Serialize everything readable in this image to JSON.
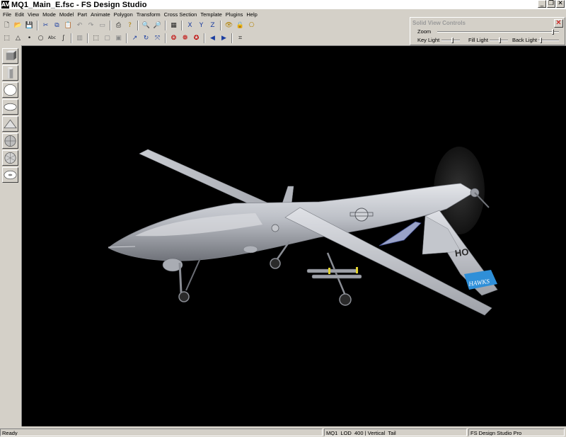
{
  "window": {
    "title": "MQ1_Main_E.fsc - FS Design Studio",
    "app_icon_glyph": "AV",
    "minimize_glyph": "_",
    "maximize_glyph": "❐",
    "close_glyph": "✕"
  },
  "menu": [
    "File",
    "Edit",
    "View",
    "Mode",
    "Model",
    "Part",
    "Animate",
    "Polygon",
    "Transform",
    "Cross Section",
    "Template",
    "Plugins",
    "Help"
  ],
  "toolbar1": [
    {
      "icon": "new-file-icon",
      "glyph": "🗋"
    },
    {
      "icon": "open-folder-icon",
      "glyph": "📂"
    },
    {
      "icon": "save-icon",
      "glyph": "💾"
    },
    {
      "sep": true
    },
    {
      "icon": "cut-icon",
      "glyph": "✂"
    },
    {
      "icon": "copy-icon",
      "glyph": "⧉"
    },
    {
      "icon": "paste-icon",
      "glyph": "📋"
    },
    {
      "icon": "undo-icon",
      "glyph": "↶"
    },
    {
      "icon": "redo-icon",
      "glyph": "↷"
    },
    {
      "icon": "grey-box-icon",
      "glyph": "▭"
    },
    {
      "sep": true
    },
    {
      "icon": "print-icon",
      "glyph": "⎙"
    },
    {
      "icon": "help-icon",
      "glyph": "?"
    },
    {
      "sep": true
    },
    {
      "icon": "zoom-in-icon",
      "glyph": "🔍"
    },
    {
      "icon": "zoom-out-icon",
      "glyph": "🔎"
    },
    {
      "sep": true
    },
    {
      "icon": "grid-icon",
      "glyph": "▦"
    },
    {
      "sep": true
    },
    {
      "icon": "axis-x-icon",
      "glyph": "X"
    },
    {
      "icon": "axis-y-icon",
      "glyph": "Y"
    },
    {
      "icon": "axis-z-icon",
      "glyph": "Z"
    },
    {
      "sep": true
    },
    {
      "icon": "eye-icon",
      "glyph": "👁"
    },
    {
      "icon": "lock-icon",
      "glyph": "🔒"
    },
    {
      "icon": "camera-icon",
      "glyph": "⎔"
    }
  ],
  "toolbar2": [
    {
      "icon": "select-box-icon",
      "glyph": "⬚"
    },
    {
      "icon": "triangle-icon",
      "glyph": "△"
    },
    {
      "icon": "point-icon",
      "glyph": "•"
    },
    {
      "icon": "circle-icon",
      "glyph": "○"
    },
    {
      "icon": "text-abc-icon",
      "glyph": "Abc"
    },
    {
      "icon": "spline-icon",
      "glyph": "∫"
    },
    {
      "sep": true
    },
    {
      "icon": "stamp-icon",
      "glyph": "▥"
    },
    {
      "sep": true
    },
    {
      "icon": "marquee-icon",
      "glyph": "⬚"
    },
    {
      "icon": "grey-square-icon",
      "glyph": "▢"
    },
    {
      "icon": "grey-square2-icon",
      "glyph": "▣"
    },
    {
      "sep": true
    },
    {
      "icon": "move-icon",
      "glyph": "↗"
    },
    {
      "icon": "rotate-icon",
      "glyph": "↻"
    },
    {
      "icon": "scale-icon",
      "glyph": "⤧"
    },
    {
      "sep": true
    },
    {
      "icon": "red-tool-1-icon",
      "glyph": "❂"
    },
    {
      "icon": "red-tool-2-icon",
      "glyph": "❁"
    },
    {
      "icon": "red-tool-3-icon",
      "glyph": "✪"
    },
    {
      "sep": true
    },
    {
      "icon": "prev-icon",
      "glyph": "◀"
    },
    {
      "icon": "next-icon",
      "glyph": "▶"
    },
    {
      "sep": true
    },
    {
      "icon": "binoculars-icon",
      "glyph": "⌗"
    }
  ],
  "solid_view_controls": {
    "title": "Solid View Controls",
    "close_glyph": "✕",
    "zoom_label": "Zoom",
    "key_light_label": "Key Light",
    "fill_light_label": "Fill Light",
    "back_light_label": "Back Light"
  },
  "palette": [
    "cube-primitive-icon",
    "cylinder-primitive-icon",
    "sphere-primitive-icon",
    "ellipsoid-primitive-icon",
    "cone-primitive-icon",
    "globe-primitive-icon",
    "geosphere-primitive-icon",
    "torus-primitive-icon"
  ],
  "markings": {
    "tail_code": "HO",
    "tail_band": "HAWKS"
  },
  "status": {
    "left": "Ready",
    "middle": "MQ1_LOD_400 | Vertical_Tail",
    "right": "FS Design Studio Pro"
  },
  "colors": {
    "face": "#d4d0c8",
    "viewport": "#000000",
    "fuselage": "#b9bcc4",
    "tail_band": "#2f8fd8"
  }
}
